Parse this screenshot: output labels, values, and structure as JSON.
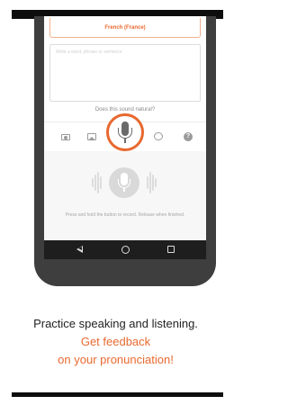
{
  "colors": {
    "accent": "#e8692f",
    "dark": "#3e3e3e",
    "navbar": "#1e1e1e"
  },
  "app": {
    "language": "French (France)",
    "input_placeholder": "Write a word, phrase or sentence",
    "question": "Does this sound natural?",
    "toolbar": {
      "icons": [
        "camera-icon",
        "image-icon",
        "microphone-icon",
        "chat-icon",
        "help-icon"
      ],
      "help_glyph": "?"
    },
    "record_hint": "Press and hold the button to record. Release when finished."
  },
  "caption": {
    "line1": "Practice speaking and listening.",
    "line2": "Get feedback",
    "line3": "on your pronunciation!"
  }
}
